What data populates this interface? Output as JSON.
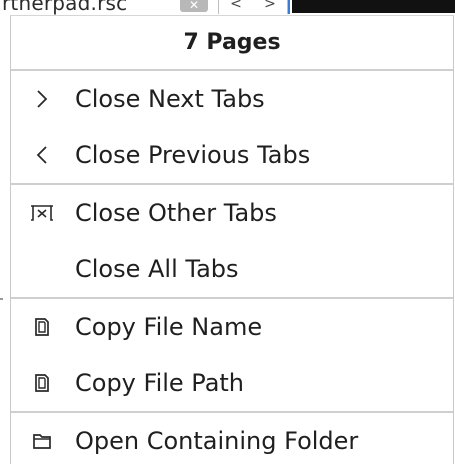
{
  "background": {
    "tab_text": "rtherpad.rsc",
    "tab_close_glyph": "✕",
    "nav_prev_glyph": "<",
    "nav_next_glyph": ">"
  },
  "menu": {
    "header": "7 Pages",
    "groups": [
      [
        {
          "icon": "chevron-right-icon",
          "label": "Close Next Tabs"
        },
        {
          "icon": "chevron-left-icon",
          "label": "Close Previous Tabs"
        }
      ],
      [
        {
          "icon": "close-other-tabs-icon",
          "label": "Close Other Tabs"
        },
        {
          "icon": "",
          "label": "Close All Tabs"
        }
      ],
      [
        {
          "icon": "copy-icon",
          "label": "Copy File Name"
        },
        {
          "icon": "copy-icon",
          "label": "Copy File Path"
        }
      ],
      [
        {
          "icon": "folder-icon",
          "label": "Open Containing Folder"
        }
      ]
    ]
  },
  "colors": {
    "text": "#1f1f1f",
    "separator": "#cfcfcf",
    "background": "#ffffff",
    "accent_blue": "#3a7bd5"
  }
}
